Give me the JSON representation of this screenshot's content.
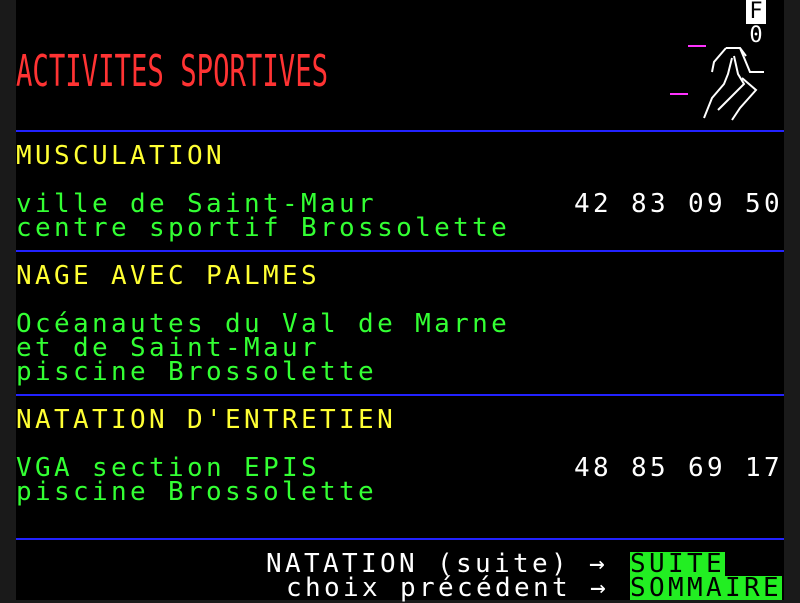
{
  "header": {
    "title": "ACTIVITES SPORTIVES",
    "page_letter": "F",
    "page_number": "0",
    "icon": "runner-icon"
  },
  "sections": [
    {
      "heading": "MUSCULATION",
      "lines": [
        "ville de Saint-Maur",
        "centre sportif Brossolette"
      ],
      "phone": "42 83 09 50"
    },
    {
      "heading": "NAGE AVEC PALMES",
      "lines": [
        "Océanautes du Val de Marne",
        "et de Saint-Maur",
        "piscine Brossolette"
      ],
      "phone": ""
    },
    {
      "heading": "NATATION D'ENTRETIEN",
      "lines": [
        "VGA section EPIS",
        "piscine Brossolette"
      ],
      "phone": "48 85 69 17"
    }
  ],
  "footer": {
    "next_label": "NATATION (suite) →",
    "next_key": "SUITE",
    "back_label": "choix précédent →",
    "back_key": "SOMMAIRE"
  },
  "colors": {
    "background": "#000000",
    "heading": "#ffff33",
    "body_text": "#33ff33",
    "title": "#ff3333",
    "separator": "#2222ff",
    "key_bg": "#22ee22"
  }
}
